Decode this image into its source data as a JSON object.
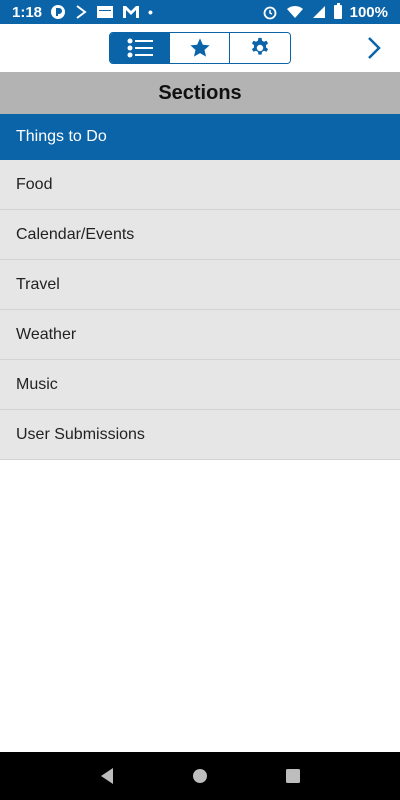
{
  "status_bar": {
    "time": "1:18",
    "battery": "100%",
    "notification_dot": "•"
  },
  "toolbar": {
    "tabs": [
      {
        "icon": "list-icon",
        "active": true
      },
      {
        "icon": "star-icon",
        "active": false
      },
      {
        "icon": "gear-icon",
        "active": false
      }
    ],
    "next_icon": "chevron-right-icon"
  },
  "sections": {
    "title": "Sections",
    "items": [
      {
        "label": "Things to Do",
        "active": true
      },
      {
        "label": "Food",
        "active": false
      },
      {
        "label": "Calendar/Events",
        "active": false
      },
      {
        "label": "Travel",
        "active": false
      },
      {
        "label": "Weather",
        "active": false
      },
      {
        "label": "Music",
        "active": false
      },
      {
        "label": "User Submissions",
        "active": false
      }
    ]
  },
  "colors": {
    "accent": "#0b63a8",
    "header_bg": "#b3b3b3",
    "item_bg": "#e6e6e6"
  }
}
